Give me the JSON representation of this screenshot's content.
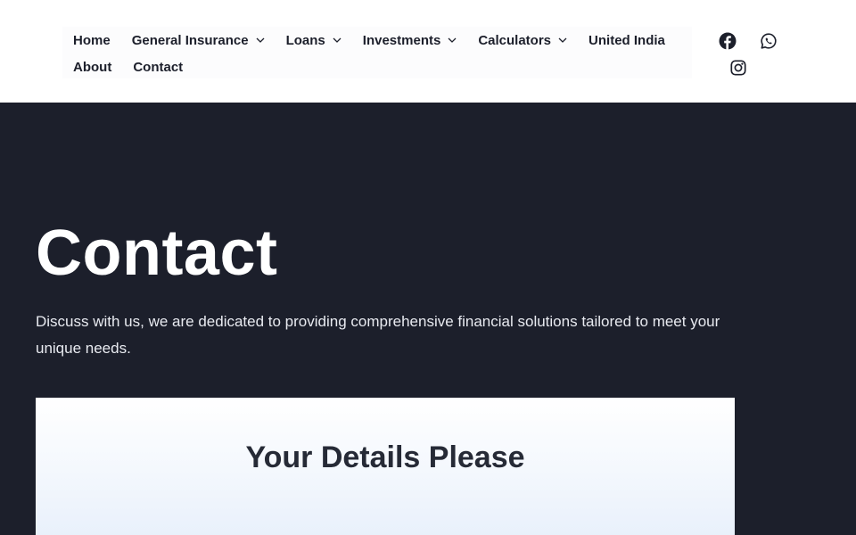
{
  "nav": {
    "row1": [
      {
        "label": "Home",
        "dropdown": false
      },
      {
        "label": "General Insurance",
        "dropdown": true
      },
      {
        "label": "Loans",
        "dropdown": true
      },
      {
        "label": "Investments",
        "dropdown": true
      },
      {
        "label": "Calculators",
        "dropdown": true
      },
      {
        "label": "United India",
        "dropdown": false
      }
    ],
    "row2": [
      {
        "label": "About",
        "dropdown": false
      },
      {
        "label": "Contact",
        "dropdown": false
      }
    ]
  },
  "social": {
    "icons": [
      "facebook-icon",
      "whatsapp-icon",
      "instagram-icon"
    ]
  },
  "hero": {
    "title": "Contact",
    "subtitle": "Discuss with us, we are dedicated to providing comprehensive financial solutions tailored to meet your unique needs."
  },
  "form": {
    "heading": "Your Details Please"
  },
  "colors": {
    "hero_background": "#1c1f2b",
    "header_background": "#ffffff",
    "nav_text": "#1c1f2b",
    "form_heading": "#262a36"
  }
}
